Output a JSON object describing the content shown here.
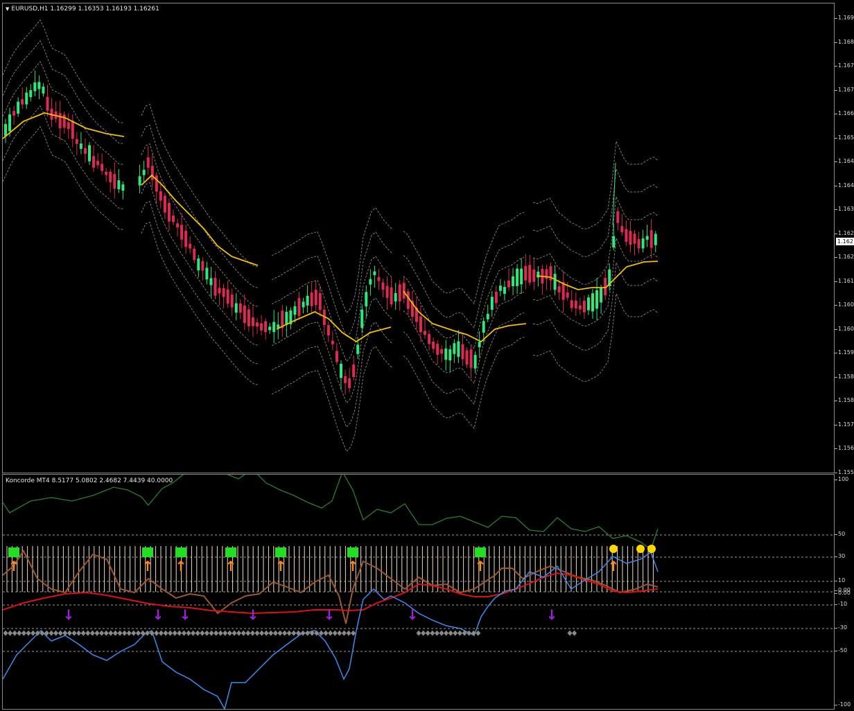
{
  "symbol_header": {
    "toggle_icon": "triangle-down-icon",
    "text": "EURUSD,H1  1.16299 1.16353 1.16193 1.16261"
  },
  "indicator_header": {
    "text": "Koncorde MT4 8.5177 5.0802 2.4682 7.4439 40.0000"
  },
  "price_axis": {
    "ticks": [
      "1.169",
      "1.168",
      "1.167",
      "1.167",
      "1.166",
      "1.165",
      "1.164",
      "1.164",
      "1.163",
      "1.162",
      "1.162",
      "1.161",
      "1.160",
      "1.160",
      "1.159",
      "1.158",
      "1.158",
      "1.157",
      "1.156",
      "1.155"
    ],
    "current_price": "1.162"
  },
  "indicator_axis": {
    "ticks": [
      "100",
      "50",
      "30",
      "10",
      "0.00",
      "0.00",
      "-10",
      "-30",
      "-50",
      "-100"
    ]
  },
  "colors": {
    "bull": "#2ee87a",
    "bear": "#dc2a52",
    "ma": "#f5c000",
    "bands": "#9a9a9a",
    "green_line": "#2f7d2f",
    "brown_line": "#9c5a2a",
    "red_line": "#e01010",
    "blue_line": "#3c8cf0",
    "histogram": "#f3dcc0",
    "up_arrow": "#ff8c1a",
    "down_arrow": "#a020e0",
    "green_square": "#20e020",
    "yellow_dot": "#ffd700",
    "diamond": "#8a8a8a"
  },
  "chart_data": {
    "type": "candlestick",
    "price_range": [
      1.155,
      1.1695
    ],
    "indicator_range": [
      -100,
      100
    ],
    "indicator_levels": [
      50,
      30,
      10,
      0,
      -10,
      -30,
      -50
    ]
  }
}
